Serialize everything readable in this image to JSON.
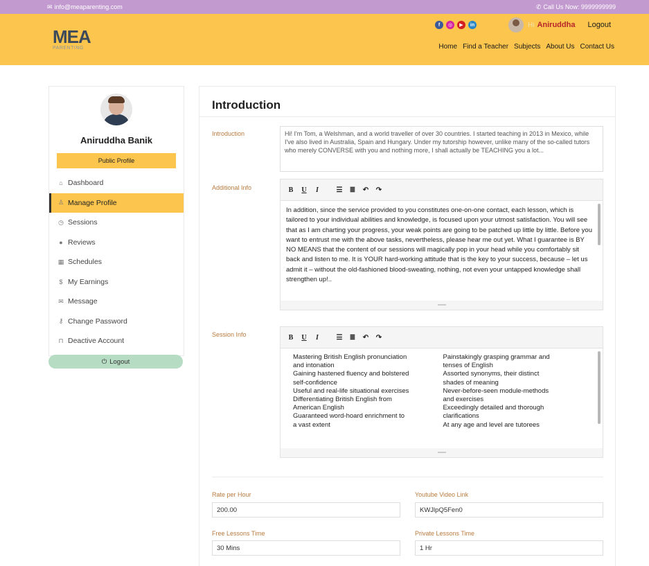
{
  "topbar": {
    "email": "info@meaparenting.com",
    "phone": "Call Us Now: 9999999999"
  },
  "header": {
    "logo_main": "MEA",
    "logo_sub": "PARENTING",
    "social": [
      "facebook-icon",
      "instagram-icon",
      "youtube-icon",
      "linkedin-icon"
    ],
    "greeting": "Hi",
    "username": "Aniruddha",
    "logout": "Logout",
    "nav": [
      "Home",
      "Find a Teacher",
      "Subjects",
      "About Us",
      "Contact Us"
    ]
  },
  "sidebar": {
    "name": "Aniruddha Banik",
    "public_profile": "Public Profile",
    "items": [
      {
        "label": "Dashboard",
        "icon": "home-icon"
      },
      {
        "label": "Manage Profile",
        "icon": "user-icon"
      },
      {
        "label": "Sessions",
        "icon": "clock-icon"
      },
      {
        "label": "Reviews",
        "icon": "comments-icon"
      },
      {
        "label": "Schedules",
        "icon": "calendar-icon"
      },
      {
        "label": "My Earnings",
        "icon": "dollar-icon"
      },
      {
        "label": "Message",
        "icon": "envelope-icon"
      },
      {
        "label": "Change Password",
        "icon": "key-icon"
      },
      {
        "label": "Deactive Account",
        "icon": "lock-icon"
      }
    ],
    "logout": "Logout"
  },
  "main": {
    "title": "Introduction",
    "introduction_label": "Introduction",
    "introduction_value": "Hi! I'm Tom, a Welshman, and a world traveller of over 30 countries. I started teaching in 2013 in Mexico, while I've also lived in Australia, Spain and Hungary. Under my tutorship however, unlike many of the so-called tutors who merely CONVERSE with you and nothing more, I shall actually be TEACHING you a lot...",
    "additional_label": "Additional Info",
    "additional_value": "In addition, since the service provided to you constitutes one-on-one contact, each lesson, which is tailored to your individual abilities and knowledge, is focused upon your utmost satisfaction. You will see that as I am charting your progress, your weak points are going to be patched up little by little. Before you want to entrust me with the above tasks, nevertheless, please hear me out yet. What I guarantee is BY NO MEANS that the content of our sessions will magically pop in your head while you comfortably sit back and listen to me. It is YOUR hard-working attitude that is the key to your success, because – let us admit it – without the old-fashioned blood-sweating, nothing, not even your untapped knowledge shall strengthen up!..",
    "toolbar": [
      "B",
      "U",
      "I",
      "ul",
      "ol",
      "undo",
      "redo"
    ],
    "session_label": "Session Info",
    "session_left": [
      "Mastering British English pronunciation",
      "and intonation",
      "Gaining hastened fluency and bolstered",
      "self-confidence",
      "Useful and real-life situational exercises",
      "Differentiating British English from",
      "American English",
      "Guaranteed word-hoard enrichment to",
      "a vast extent"
    ],
    "session_right": [
      "Painstakingly grasping grammar and",
      "tenses of English",
      "Assorted synonyms, their distinct",
      "shades of meaning",
      "Never-before-seen module-methods",
      "and exercises",
      "Exceedingly detailed and thorough",
      "clarifications",
      "At any age and level are tutorees"
    ],
    "rate_label": "Rate per Hour",
    "rate_value": "200.00",
    "youtube_label": "Youtube Video Link",
    "youtube_value": "KWJlpQ5Fen0",
    "free_label": "Free Lessons Time",
    "free_value": "30 Mins",
    "private_label": "Private Lessons Time",
    "private_value": "1 Hr"
  },
  "colors": {
    "primary": "#fcc54d",
    "topbar": "#c39ad0",
    "label": "#b97b3f",
    "logout": "#b7dcc4",
    "username": "#b7242a"
  }
}
